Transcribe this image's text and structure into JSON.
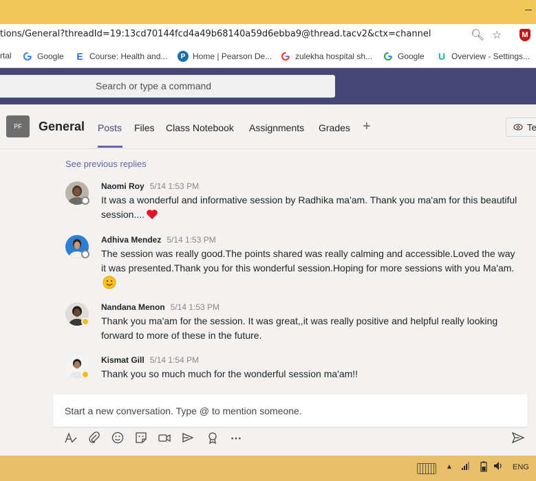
{
  "browser": {
    "url": "tions/General?threadId=19:13cd70144fcd4a49b68140a59d6ebba9@thread.tacv2&ctx=channel",
    "bookmarks": [
      {
        "label": "rtal",
        "icon": "none"
      },
      {
        "label": "Google",
        "icon": "google-icon"
      },
      {
        "label": "Course: Health and...",
        "icon": "e-icon"
      },
      {
        "label": "Home | Pearson De...",
        "icon": "pearson-icon"
      },
      {
        "label": "zulekha hospital sh...",
        "icon": "google-icon"
      },
      {
        "label": "Google",
        "icon": "google-icon"
      },
      {
        "label": "Overview - Settings...",
        "icon": "u-icon"
      }
    ]
  },
  "teams": {
    "search_placeholder": "Search or type a command",
    "team_initials": "PF",
    "channel_name": "General",
    "tabs": [
      "Posts",
      "Files",
      "Class Notebook",
      "Assignments",
      "Grades"
    ],
    "active_tab": "Posts",
    "team_button_label": "Tea",
    "see_previous": "See previous replies",
    "messages": [
      {
        "author": "Naomi Roy",
        "time": "5/14 1:53 PM",
        "text": "It was a wonderful and informative session by Radhika ma'am. Thank you ma'am for this beautiful session....",
        "status": "offline",
        "emoji": "heart-emoji"
      },
      {
        "author": "Adhiva Mendez",
        "time": "5/14 1:53 PM",
        "text": "The session was really good.The points shared was really calming and accessible.Loved the way it was presented.Thank you for this wonderful session.Hoping for more sessions with you Ma'am.",
        "status": "offline",
        "emoji": "smile-emoji"
      },
      {
        "author": "Nandana Menon",
        "time": "5/14 1:53 PM",
        "text": "Thank you ma'am for the session. It was great,,it was really positive and helpful really looking forward to more of these in the future.",
        "status": "away",
        "emoji": ""
      },
      {
        "author": "Kismat Gill",
        "time": "5/14 1:54 PM",
        "text": "Thank you so much much for the wonderful session ma'am!!",
        "status": "away",
        "emoji": ""
      }
    ],
    "compose_placeholder": "Start a new conversation. Type @ to mention someone."
  },
  "taskbar": {
    "language": "ENG"
  },
  "colors": {
    "teams_purple": "#464775",
    "accent": "#6264a7",
    "titlebar": "#f0c85a",
    "taskbar": "#e8bf6a"
  }
}
